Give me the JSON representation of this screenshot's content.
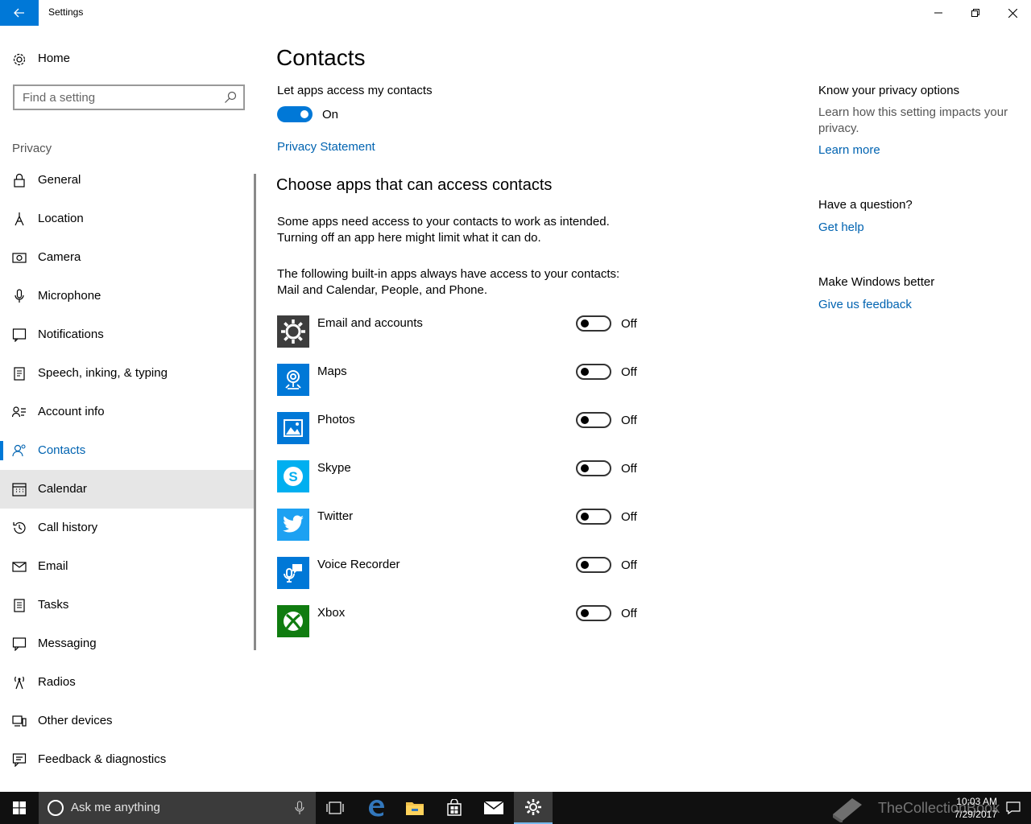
{
  "window": {
    "title": "Settings"
  },
  "sidebar": {
    "home_label": "Home",
    "search_placeholder": "Find a setting",
    "section_label": "Privacy",
    "items": [
      {
        "label": "General",
        "icon": "lock-icon"
      },
      {
        "label": "Location",
        "icon": "location-icon"
      },
      {
        "label": "Camera",
        "icon": "camera-icon"
      },
      {
        "label": "Microphone",
        "icon": "microphone-icon"
      },
      {
        "label": "Notifications",
        "icon": "notifications-icon"
      },
      {
        "label": "Speech, inking, & typing",
        "icon": "speech-icon"
      },
      {
        "label": "Account info",
        "icon": "account-info-icon"
      },
      {
        "label": "Contacts",
        "icon": "contacts-icon",
        "selected": true
      },
      {
        "label": "Calendar",
        "icon": "calendar-icon"
      },
      {
        "label": "Call history",
        "icon": "history-icon"
      },
      {
        "label": "Email",
        "icon": "email-icon"
      },
      {
        "label": "Tasks",
        "icon": "tasks-icon"
      },
      {
        "label": "Messaging",
        "icon": "messaging-icon"
      },
      {
        "label": "Radios",
        "icon": "radios-icon"
      },
      {
        "label": "Other devices",
        "icon": "other-devices-icon"
      },
      {
        "label": "Feedback & diagnostics",
        "icon": "feedback-icon"
      }
    ]
  },
  "main": {
    "title": "Contacts",
    "toggle_label": "Let apps access my contacts",
    "toggle_state": "On",
    "privacy_link": "Privacy Statement",
    "subheading": "Choose apps that can access contacts",
    "para1_line1": "Some apps need access to your contacts to work as intended.",
    "para1_line2": "Turning off an app here might limit what it can do.",
    "para2_line1": "The following built-in apps always have access to your contacts:",
    "para2_line2": "Mail and Calendar, People, and Phone.",
    "apps": [
      {
        "name": "Email and accounts",
        "state": "Off",
        "icon": "gear-icon",
        "color": "#3d3d3d"
      },
      {
        "name": "Maps",
        "state": "Off",
        "icon": "maps-icon",
        "color": "#0078d7"
      },
      {
        "name": "Photos",
        "state": "Off",
        "icon": "photos-icon",
        "color": "#0078d7"
      },
      {
        "name": "Skype",
        "state": "Off",
        "icon": "skype-icon",
        "color": "#00aff0"
      },
      {
        "name": "Twitter",
        "state": "Off",
        "icon": "twitter-icon",
        "color": "#1da1f2"
      },
      {
        "name": "Voice Recorder",
        "state": "Off",
        "icon": "voice-recorder-icon",
        "color": "#0078d7"
      },
      {
        "name": "Xbox",
        "state": "Off",
        "icon": "xbox-icon",
        "color": "#107c10"
      }
    ]
  },
  "right": {
    "privacy_heading": "Know your privacy options",
    "privacy_text": "Learn how this setting impacts your privacy.",
    "learn_more": "Learn more",
    "question_heading": "Have a question?",
    "get_help": "Get help",
    "better_heading": "Make Windows better",
    "feedback_link": "Give us feedback"
  },
  "taskbar": {
    "search_text": "Ask me anything",
    "time": "10:03 AM",
    "date": "7/29/2017",
    "watermark": "TheCollectionBook"
  },
  "colors": {
    "accent": "#0078d7",
    "link": "#0063b1",
    "hover": "#e6e6e6",
    "taskbar": "#101010"
  }
}
